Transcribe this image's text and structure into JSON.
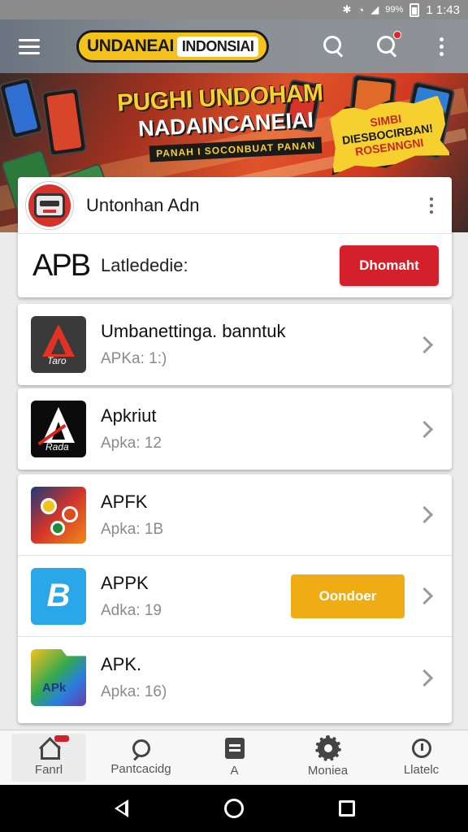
{
  "status_bar": {
    "time": "1 1:43",
    "battery_text": "99%",
    "icons": [
      "bluetooth-icon",
      "wifi-icon",
      "signal-icon",
      "battery-icon"
    ]
  },
  "app_bar": {
    "brand_part1": "UNDANEAI",
    "brand_part2": "INDONSIAI",
    "icons": [
      "hamburger-menu-icon",
      "search-icon",
      "search-notification-icon",
      "overflow-menu-icon"
    ]
  },
  "banner": {
    "headline": "PUGHI UNDOHAM",
    "subheadline": "NADAINCANEIAI",
    "ribbon": "PANAH I SOCONBUAT PANAN",
    "burst_line1": "SIMBI",
    "burst_line2": "DIESBOCIRBAN!",
    "burst_line3": "ROSENNGNI"
  },
  "featured": {
    "title": "Untonhan Adn",
    "code": "APB",
    "label": "Latlededie:",
    "button_label": "Dhomaht",
    "icons": [
      "robot-avatar-icon",
      "overflow-menu-icon"
    ]
  },
  "apps": [
    {
      "name": "Umbanettinga. banntuk",
      "meta": "APKa: 1:)",
      "icon": "red-triangle-app-icon",
      "icon_label": "Taro"
    },
    {
      "name": "Apkriut",
      "meta": "Apka: 12",
      "icon": "black-triangle-app-icon",
      "icon_label": "Rada"
    },
    {
      "name": "APFK",
      "meta": "Apka: 1B",
      "icon": "colorful-flower-app-icon"
    },
    {
      "name": "APPK",
      "meta": "Adka: 19",
      "icon": "blue-b-app-icon",
      "icon_label": "B",
      "button_label": "Oondoer"
    },
    {
      "name": "APK.",
      "meta": "Apka: 16)",
      "icon": "gradient-folder-app-icon",
      "icon_label": "APk"
    }
  ],
  "bottom_nav": [
    {
      "label": "Fanrl",
      "icon": "home-icon",
      "active": true
    },
    {
      "label": "Pantcacidg",
      "icon": "chat-icon",
      "active": false
    },
    {
      "label": "A",
      "icon": "document-icon",
      "active": false
    },
    {
      "label": "Moniea",
      "icon": "gear-icon",
      "active": false
    },
    {
      "label": "Llatelc",
      "icon": "info-icon",
      "active": false
    }
  ],
  "colors": {
    "primary_red": "#d4202a",
    "accent_yellow": "#f0ac14",
    "brand_yellow": "#f4c21a",
    "app_bar_gray": "#8a8f95"
  }
}
